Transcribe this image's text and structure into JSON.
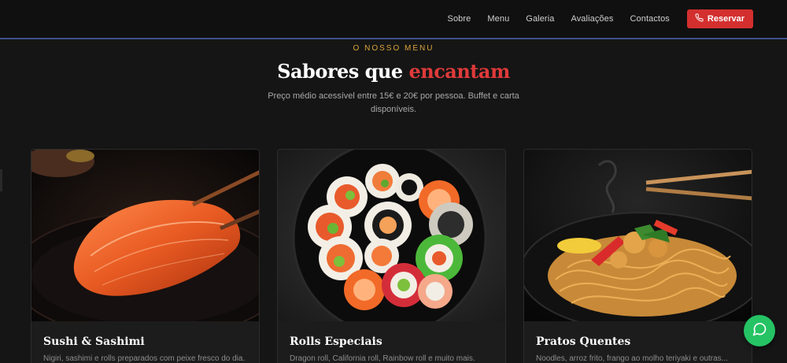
{
  "nav": {
    "links": [
      "Sobre",
      "Menu",
      "Galeria",
      "Avaliações",
      "Contactos"
    ],
    "cta_label": "Reservar"
  },
  "section": {
    "eyebrow": "O NOSSO MENU",
    "title_main": "Sabores que ",
    "title_accent": "encantam",
    "subtitle": "Preço médio acessível entre 15€ e 20€ por pessoa. Buffet e carta disponíveis."
  },
  "cards": [
    {
      "title": "Sushi & Sashimi",
      "description": "Nigiri, sashimi e rolls preparados com peixe fresco do dia."
    },
    {
      "title": "Rolls Especiais",
      "description": "Dragon roll, California roll, Rainbow roll e muito mais."
    },
    {
      "title": "Pratos Quentes",
      "description": "Noodles, arroz frito, frango ao molho teriyaki e outras..."
    }
  ],
  "colors": {
    "accent_red": "#d32f2f",
    "gold": "#d9a43b",
    "whatsapp_green": "#25c364"
  }
}
